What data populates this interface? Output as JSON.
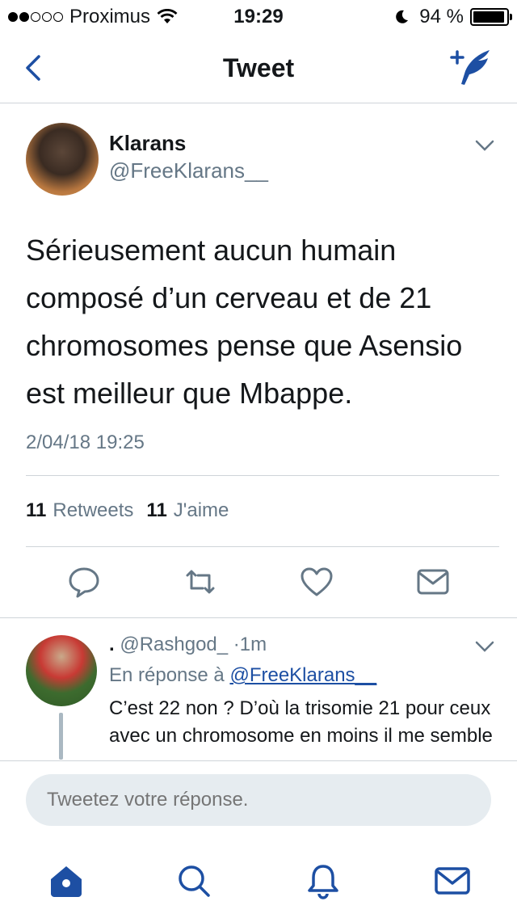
{
  "status_bar": {
    "carrier": "Proximus",
    "time": "19:29",
    "battery_percent": "94 %",
    "battery_level": 0.94
  },
  "nav": {
    "title": "Tweet",
    "back_icon": "chevron-left-icon",
    "compose_icon": "compose-tweet-icon"
  },
  "tweet": {
    "author_name": "Klarans",
    "author_handle": "@FreeKlarans__",
    "text": "Sérieusement aucun humain composé d’un cerveau et de 21 chromosomes pense que Asensio est meilleur que Mbappe.",
    "timestamp": "2/04/18 19:25",
    "retweet_count": "11",
    "retweet_label": "Retweets",
    "like_count": "11",
    "like_label": "J'aime"
  },
  "reply": {
    "name": ".",
    "handle": "@Rashgod_",
    "separator": "·",
    "time": "1m",
    "in_reply_label": "En réponse à",
    "in_reply_handle": "@FreeKlarans__",
    "text": "C’est 22 non ? D’où la trisomie 21 pour ceux avec un chromosome en moins il me semble"
  },
  "composer": {
    "placeholder": "Tweetez votre réponse."
  },
  "colors": {
    "accent": "#1d4fa3",
    "text": "#14171a",
    "muted": "#657786",
    "divider": "#cfd4d9"
  }
}
